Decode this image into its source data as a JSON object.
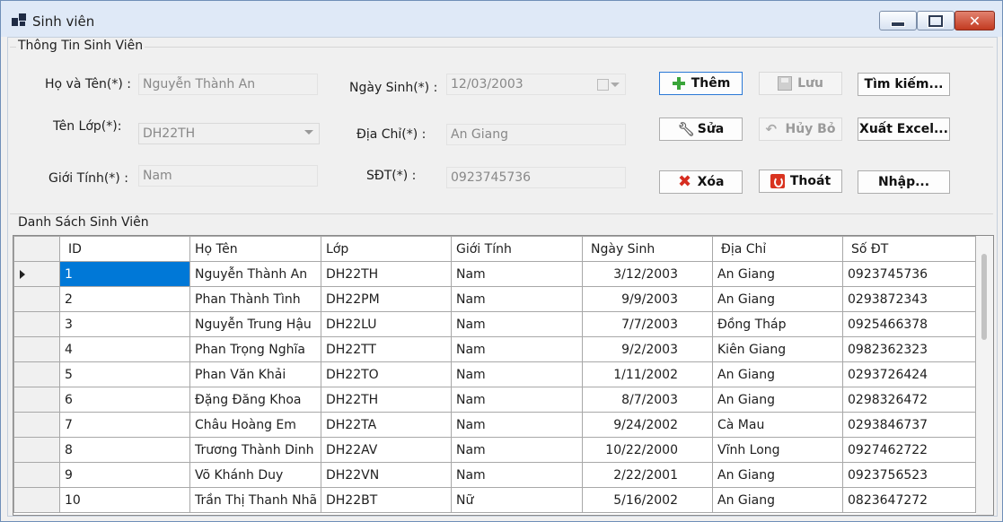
{
  "window": {
    "title": "Sinh viên"
  },
  "info_group": {
    "title": "Thông Tin Sinh Viên",
    "fields": {
      "name": {
        "label": "Họ và Tên(*) :",
        "value": "Nguyễn Thành An"
      },
      "class": {
        "label": "Tên Lớp(*):",
        "value": "DH22TH"
      },
      "gender": {
        "label": "Giới Tính(*) :",
        "value": "Nam"
      },
      "dob": {
        "label": "Ngày Sinh(*) :",
        "value": "12/03/2003"
      },
      "address": {
        "label": "Địa Chỉ(*) :",
        "value": "An Giang"
      },
      "phone": {
        "label": "SĐT(*) :",
        "value": "0923745736"
      }
    },
    "buttons": {
      "add": "Thêm",
      "save": "Lưu",
      "search": "Tìm kiếm...",
      "edit": "Sửa",
      "cancel": "Hủy Bỏ",
      "export": "Xuất Excel...",
      "delete": "Xóa",
      "exit": "Thoát",
      "import": "Nhập..."
    }
  },
  "list_group": {
    "title": "Danh Sách Sinh Viên",
    "columns": [
      "ID",
      "Họ Tên",
      "Lớp",
      "Giới Tính",
      "Ngày Sinh",
      "Địa Chỉ",
      "Số ĐT"
    ],
    "rows": [
      [
        "1",
        "Nguyễn Thành An",
        "DH22TH",
        "Nam",
        "3/12/2003",
        "An Giang",
        "0923745736"
      ],
      [
        "2",
        "Phan Thành Tình",
        "DH22PM",
        "Nam",
        "9/9/2003",
        "An Giang",
        "0293872343"
      ],
      [
        "3",
        "Nguyễn Trung Hậu",
        "DH22LU",
        "Nam",
        "7/7/2003",
        "Đồng Tháp",
        "0925466378"
      ],
      [
        "4",
        "Phan Trọng Nghĩa",
        "DH22TT",
        "Nam",
        "9/2/2003",
        "Kiên Giang",
        "0982362323"
      ],
      [
        "5",
        "Phan Văn Khải",
        "DH22TO",
        "Nam",
        "1/11/2002",
        "An Giang",
        "0293726424"
      ],
      [
        "6",
        "Đặng Đăng Khoa",
        "DH22TH",
        "Nam",
        "8/7/2003",
        "An Giang",
        "0298326472"
      ],
      [
        "7",
        "Châu Hoàng Em",
        "DH22TA",
        "Nam",
        "9/24/2002",
        "Cà Mau",
        "0293846737"
      ],
      [
        "8",
        "Trương Thành Dinh",
        "DH22AV",
        "Nam",
        "10/22/2000",
        "Vĩnh Long",
        "0927462722"
      ],
      [
        "9",
        "Võ Khánh Duy",
        "DH22VN",
        "Nam",
        "2/22/2001",
        "An Giang",
        "0923756523"
      ],
      [
        "10",
        "Trần Thị Thanh Nhã",
        "DH22BT",
        "Nữ",
        "5/16/2002",
        "An Giang",
        "0823647272"
      ]
    ]
  }
}
